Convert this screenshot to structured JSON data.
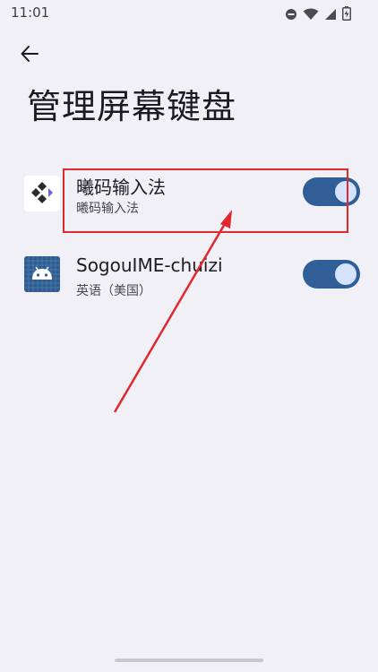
{
  "status_bar": {
    "time": "11:01",
    "icons": [
      "do-not-disturb-icon",
      "wifi-icon",
      "signal-icon",
      "battery-charging-icon"
    ]
  },
  "header": {
    "back_icon": "arrow-back-icon",
    "title": "管理屏幕键盘"
  },
  "keyboards": [
    {
      "name": "曦码输入法",
      "subtitle": "曦码输入法",
      "icon": "ximalaya-ime-icon",
      "enabled": true
    },
    {
      "name": "SogouIME-chuizi",
      "subtitle": "英语（美国）",
      "icon": "android-icon",
      "enabled": true
    }
  ],
  "annotation": {
    "highlight_color": "#e0282e"
  },
  "colors": {
    "switch_track_on": "#2f5f96",
    "switch_thumb": "#d6e3ff",
    "background": "#f1f0f6"
  }
}
